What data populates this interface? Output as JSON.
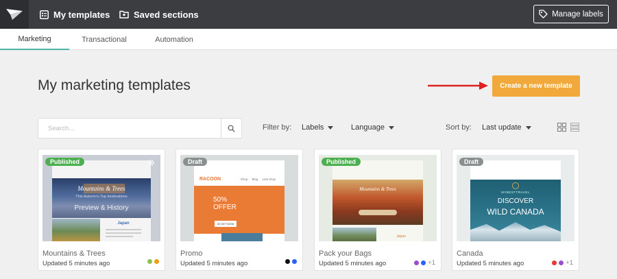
{
  "header": {
    "nav": [
      {
        "label": "My templates",
        "icon": "template-icon"
      },
      {
        "label": "Saved sections",
        "icon": "folder-icon"
      }
    ],
    "manage_labels": "Manage labels"
  },
  "tabs": [
    "Marketing",
    "Transactional",
    "Automation"
  ],
  "active_tab": "Marketing",
  "page_title": "My marketing templates",
  "create_button": "Create a new template",
  "search": {
    "placeholder": "Search..."
  },
  "filters": {
    "filter_by_label": "Filter by:",
    "labels": "Labels",
    "language": "Language",
    "sort_by_label": "Sort by:",
    "sort_value": "Last update"
  },
  "templates": [
    {
      "name": "Mountains & Trees",
      "status": "Published",
      "updated": "Updated 5 minutes ago",
      "label_colors": [
        "#8bc34a",
        "#f39c12"
      ],
      "extra": "",
      "thumb": {
        "hero_title": "Mountains & Trees",
        "hero_sub": "This Autumn's Top destinations",
        "hero_cta": "Preview & History",
        "side_title": "Japan"
      }
    },
    {
      "name": "Promo",
      "status": "Draft",
      "updated": "Updated 5 minutes ago",
      "label_colors": [
        "#111111",
        "#2962ff"
      ],
      "extra": "",
      "thumb": {
        "brand": "RACOON",
        "nav1": "Shop",
        "nav2": "Blog",
        "nav3": "Lets shop",
        "offer_pct": "50%",
        "offer_word": "OFFER",
        "cta": "20 GET NOW"
      }
    },
    {
      "name": "Pack your Bags",
      "status": "Published",
      "updated": "Updated 5 minutes ago",
      "label_colors": [
        "#9c4dcc",
        "#2962ff"
      ],
      "extra": "+1",
      "thumb": {
        "hero_title": "Mountains & Trees",
        "side_title": "Japan"
      }
    },
    {
      "name": "Canada",
      "status": "Draft",
      "updated": "Updated 5 minutes ago",
      "label_colors": [
        "#e53935",
        "#9c4dcc"
      ],
      "extra": "+1",
      "thumb": {
        "brand": "MYBESTTRAVEL",
        "line1": "DISCOVER",
        "line2": "WILD CANADA"
      }
    }
  ]
}
